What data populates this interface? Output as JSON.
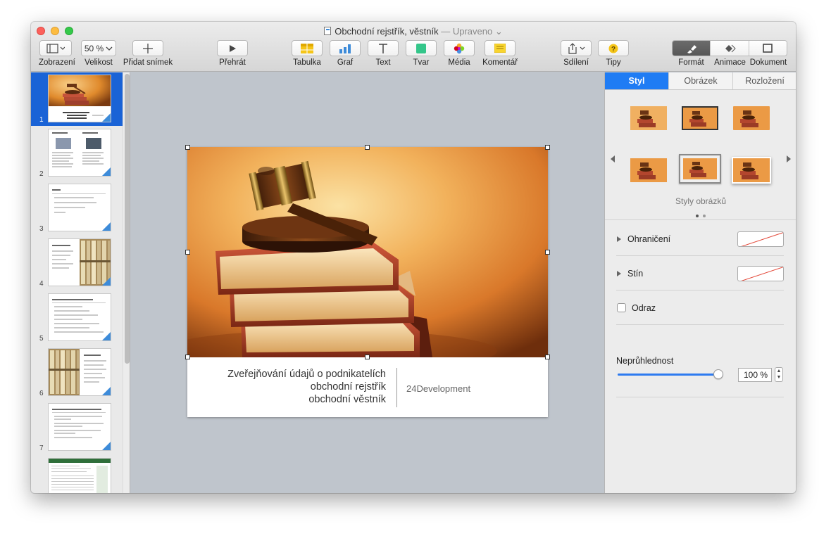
{
  "window": {
    "title": "Obchodní rejstřík, věstník",
    "modified": "— Upraveno"
  },
  "toolbar": {
    "view_label": "Zobrazení",
    "zoom_value": "50 %",
    "zoom_label": "Velikost",
    "add_slide_label": "Přidat snímek",
    "play_label": "Přehrát",
    "table_label": "Tabulka",
    "chart_label": "Graf",
    "text_label": "Text",
    "shape_label": "Tvar",
    "media_label": "Média",
    "comment_label": "Komentář",
    "share_label": "Sdílení",
    "tips_label": "Tipy",
    "format_label": "Formát",
    "animate_label": "Animace",
    "document_label": "Dokument"
  },
  "slides": {
    "numbers": [
      "1",
      "2",
      "3",
      "4",
      "5",
      "6",
      "7"
    ],
    "selected": "1"
  },
  "slide": {
    "caption_line1": "Zveřejňování údajů o podnikatelích",
    "caption_line2": "obchodní rejstřík",
    "caption_line3": "obchodní věstník",
    "company": "24Development"
  },
  "inspector": {
    "tabs": [
      "Styl",
      "Obrázek",
      "Rozložení"
    ],
    "active_tab": "Styl",
    "styles_label": "Styly obrázků",
    "border_label": "Ohraničení",
    "shadow_label": "Stín",
    "reflection_label": "Odraz",
    "opacity_label": "Neprůhlednost",
    "opacity_value": "100 %",
    "opacity_fraction": 1.0
  },
  "colors": {
    "accent": "#1f7cf4",
    "selection": "#1a63d6"
  }
}
